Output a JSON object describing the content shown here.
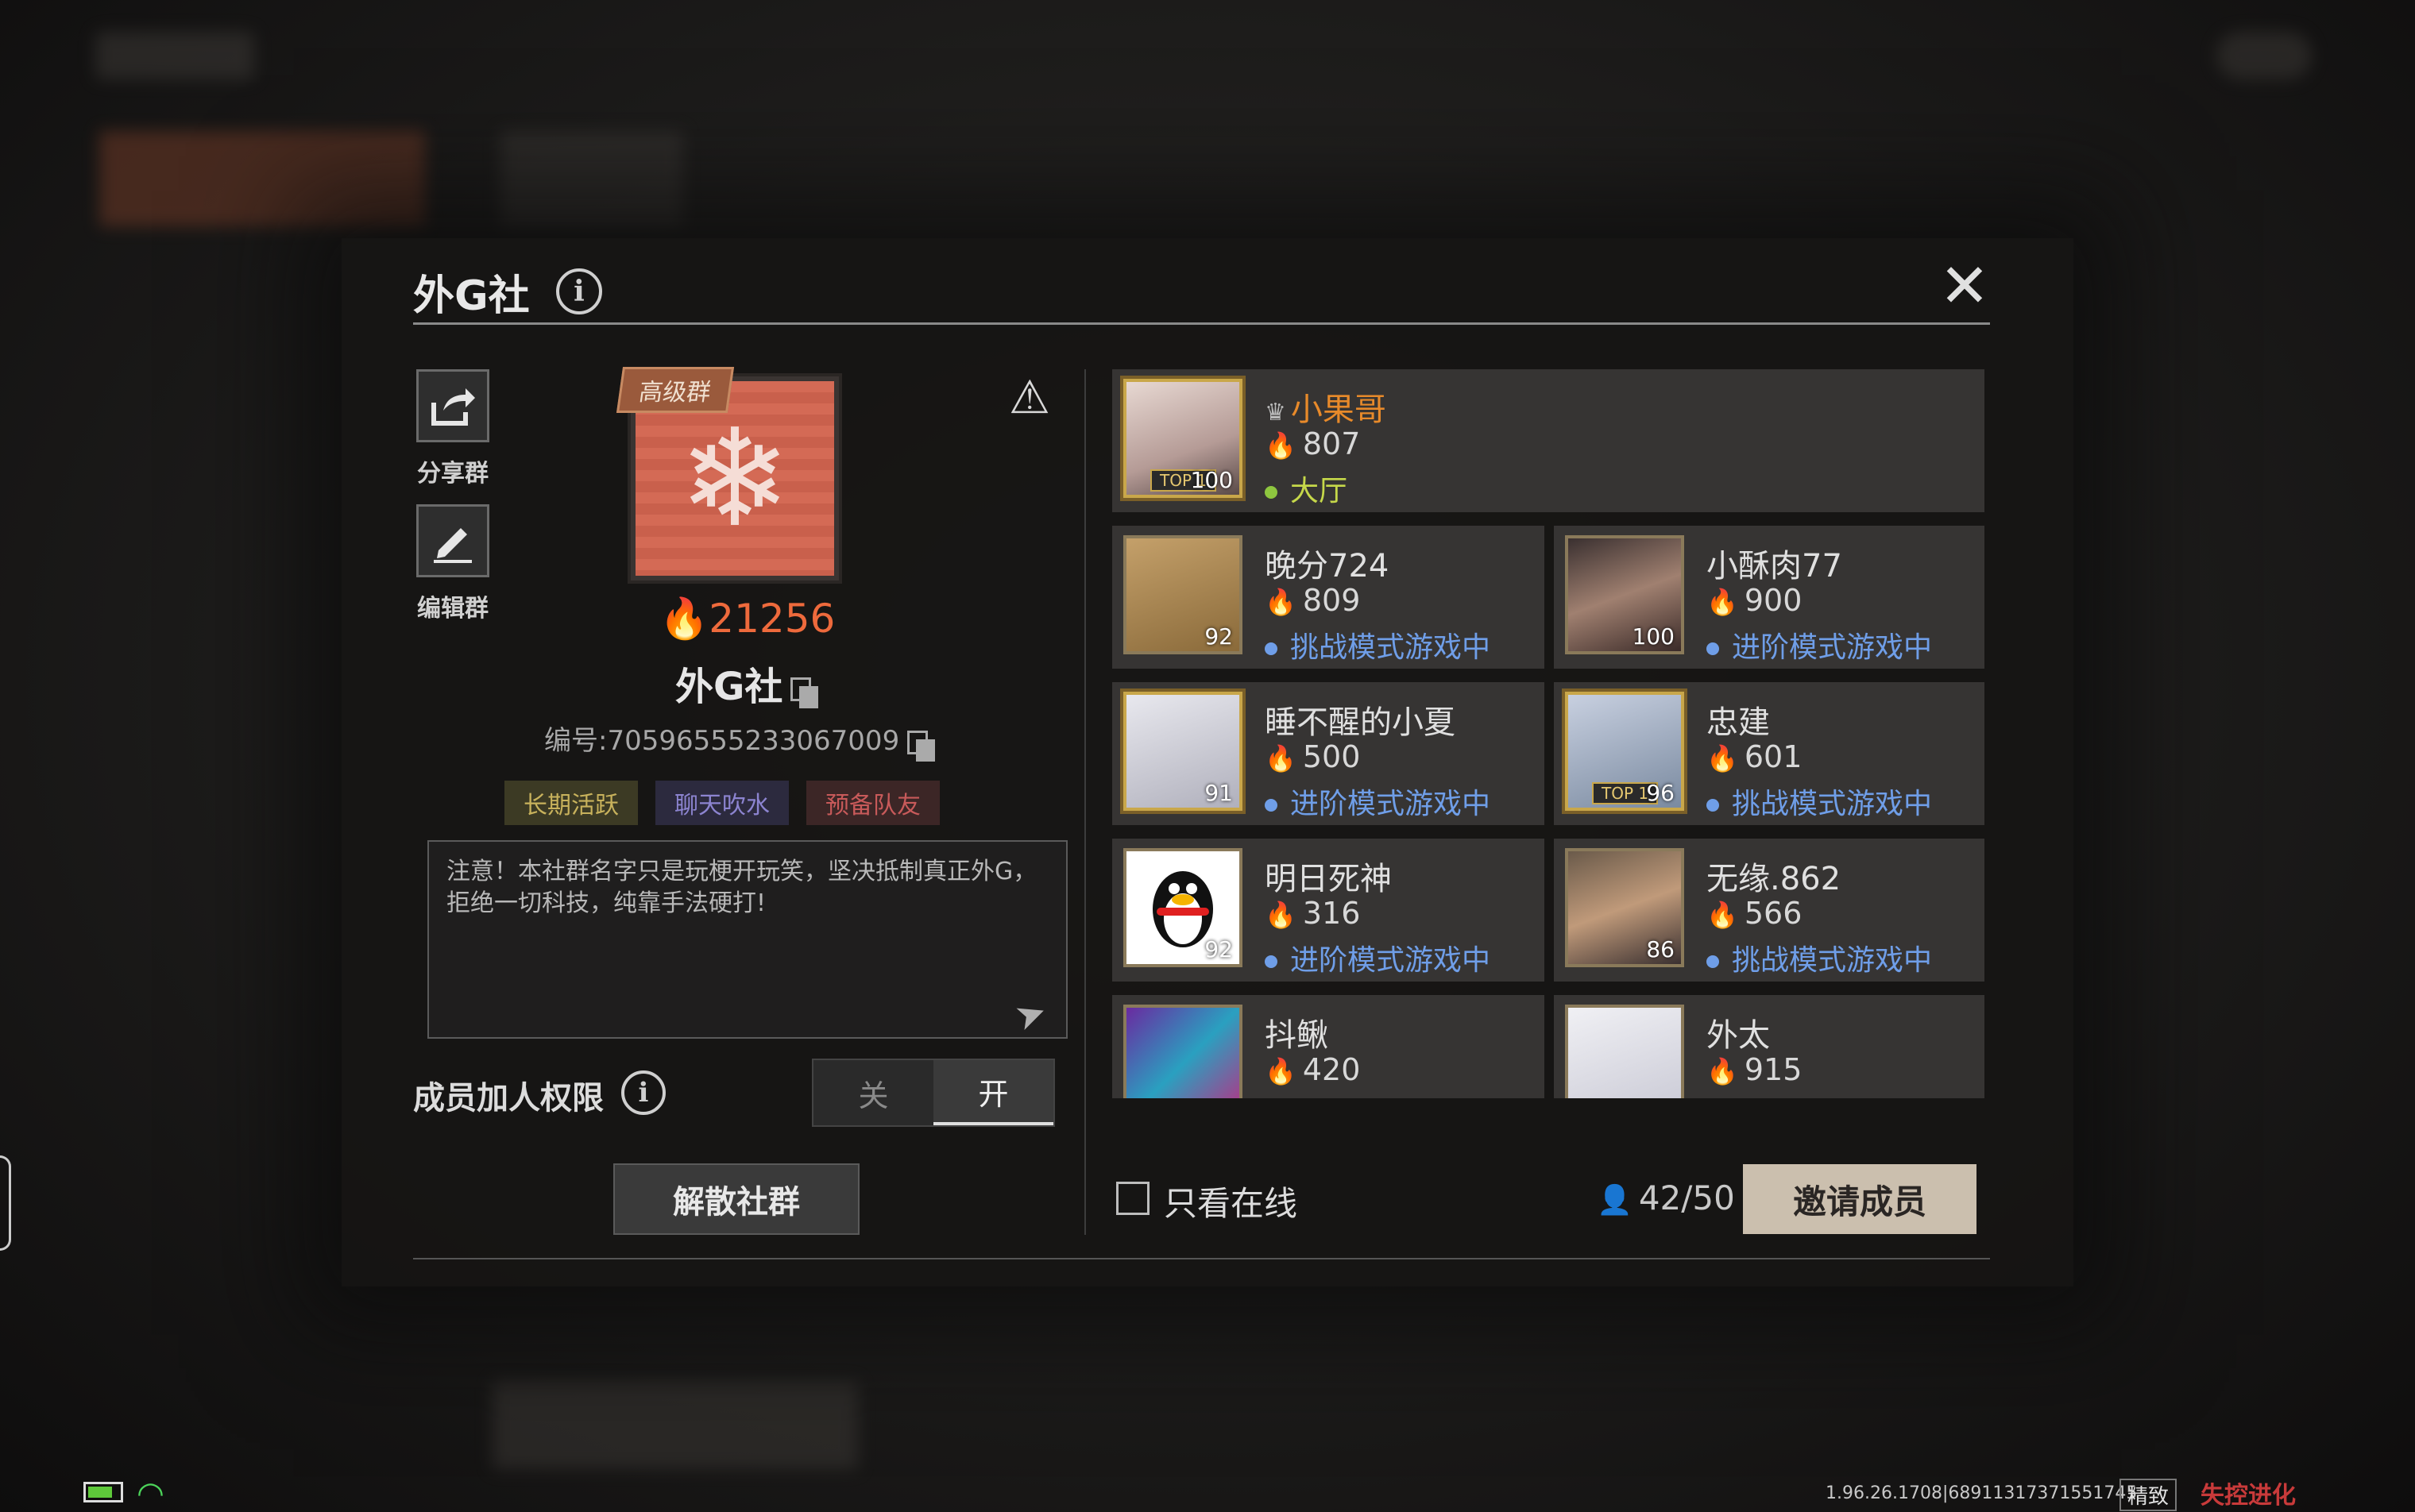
{
  "dialog": {
    "title": "外G社",
    "close_glyph": "✕"
  },
  "sidebar": {
    "share_label": "分享群",
    "edit_label": "编辑群"
  },
  "group": {
    "badge": "高级群",
    "heat": "21256",
    "name": "外G社",
    "id_text": "编号:70596555233067009",
    "tags": [
      "长期活跃",
      "聊天吹水",
      "预备队友"
    ],
    "notice": "注意！本社群名字只是玩梗开玩笑，坚决抵制真正外G，拒绝一切科技，纯靠手法硬打!"
  },
  "permission": {
    "label": "成员加人权限",
    "off_label": "关",
    "on_label": "开",
    "selected": "开"
  },
  "dissolve_label": "解散社群",
  "members": [
    {
      "name": "小果哥",
      "heat": "807",
      "status": "大厅",
      "level": "100",
      "owner": true,
      "top1": "TOP 1"
    },
    {
      "name": "晚分724",
      "heat": "809",
      "status": "挑战模式游戏中",
      "level": "92"
    },
    {
      "name": "小酥肉77",
      "heat": "900",
      "status": "进阶模式游戏中",
      "level": "100"
    },
    {
      "name": "睡不醒的小夏",
      "heat": "500",
      "status": "进阶模式游戏中",
      "level": "91"
    },
    {
      "name": "忠建",
      "heat": "601",
      "status": "挑战模式游戏中",
      "level": "96",
      "top1": "TOP 1"
    },
    {
      "name": "明日死神",
      "heat": "316",
      "status": "进阶模式游戏中",
      "level": "92"
    },
    {
      "name": "无缘.862",
      "heat": "566",
      "status": "挑战模式游戏中",
      "level": "86"
    },
    {
      "name": "抖鳅",
      "heat": "420"
    },
    {
      "name": "外太",
      "heat": "915"
    }
  ],
  "footer": {
    "online_only_label": "只看在线",
    "member_count": "42/50",
    "invite_label": "邀请成员"
  },
  "statusbar": {
    "version": "1.96.26.1708|68911317371551745",
    "quality": "精致",
    "logo": "失控进化"
  },
  "colors": {
    "accent": "#ee6a3c",
    "owner_name": "#e88a2a",
    "status_blue": "#6f9ee8",
    "status_lobby": "#c6d84a",
    "invite_bg": "#cbbfae"
  }
}
